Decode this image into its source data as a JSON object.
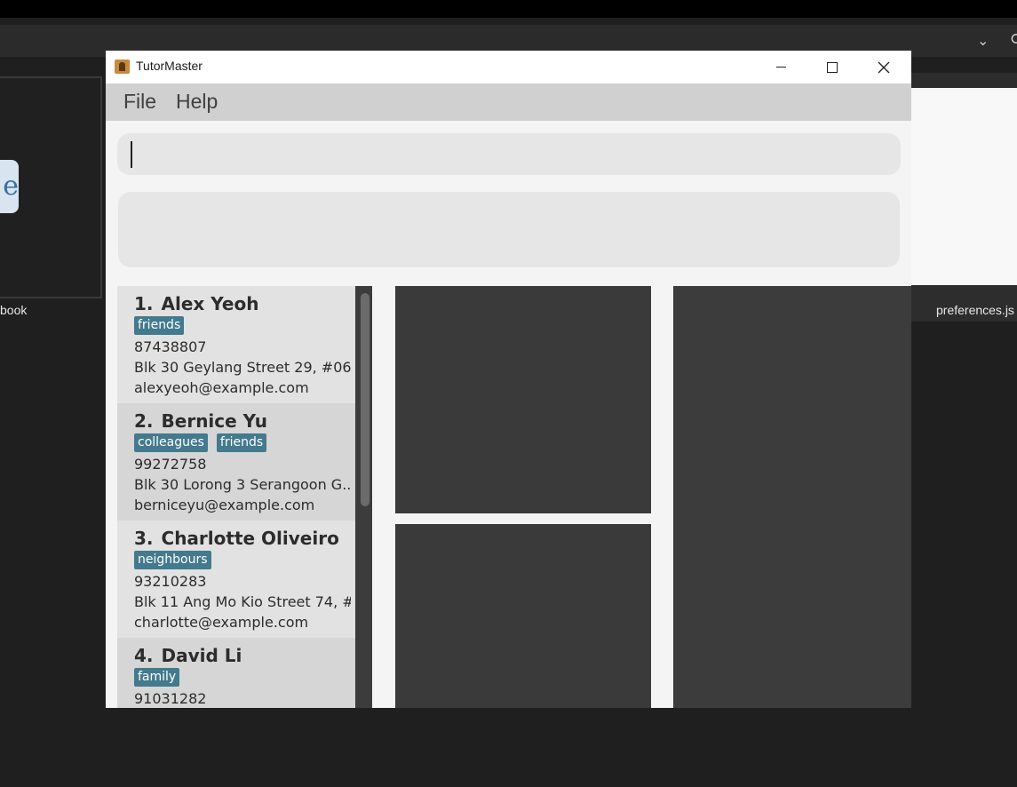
{
  "background": {
    "left_label": "book",
    "right_label": "preferences.js"
  },
  "window": {
    "title": "TutorMaster"
  },
  "menu": {
    "file": "File",
    "help": "Help"
  },
  "command_box": {
    "value": ""
  },
  "result_box": {
    "text": ""
  },
  "persons": [
    {
      "index": "1.",
      "name": "Alex Yeoh",
      "tags": [
        "friends"
      ],
      "phone": "87438807",
      "address": "Blk 30 Geylang Street 29, #06-...",
      "email": "alexyeoh@example.com"
    },
    {
      "index": "2.",
      "name": "Bernice Yu",
      "tags": [
        "colleagues",
        "friends"
      ],
      "phone": "99272758",
      "address": "Blk 30 Lorong 3 Serangoon G...",
      "email": "berniceyu@example.com"
    },
    {
      "index": "3.",
      "name": "Charlotte Oliveiro",
      "tags": [
        "neighbours"
      ],
      "phone": "93210283",
      "address": "Blk 11 Ang Mo Kio Street 74, #...",
      "email": "charlotte@example.com"
    },
    {
      "index": "4.",
      "name": "David Li",
      "tags": [
        "family"
      ],
      "phone": "91031282",
      "address": "",
      "email": ""
    }
  ],
  "colors": {
    "tag": "#437a8e",
    "menubar": "#d0d0d0",
    "panel_dark": "#3a3a3a"
  },
  "icons": {
    "app": "app-icon",
    "minimize": "minimize-icon",
    "maximize": "maximize-icon",
    "close": "close-icon"
  }
}
